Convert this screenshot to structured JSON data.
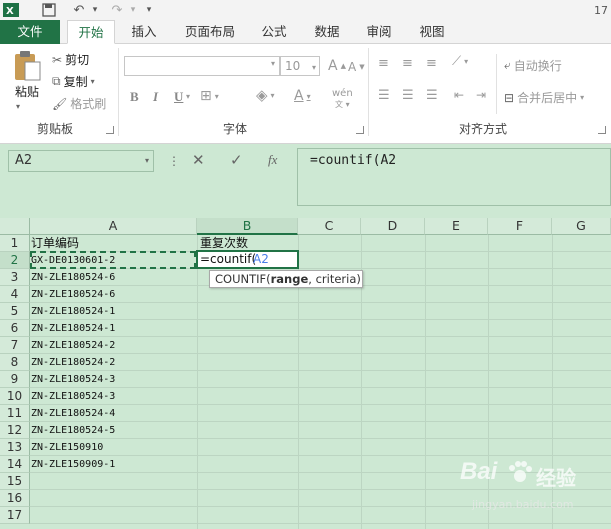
{
  "titlebar": {
    "number": "17"
  },
  "tabs": [
    {
      "label": "文件"
    },
    {
      "label": "开始"
    },
    {
      "label": "插入"
    },
    {
      "label": "页面布局"
    },
    {
      "label": "公式"
    },
    {
      "label": "数据"
    },
    {
      "label": "审阅"
    },
    {
      "label": "视图"
    }
  ],
  "clipboard": {
    "paste": "粘贴",
    "cut": "剪切",
    "copy": "复制",
    "format_painter": "格式刷",
    "group": "剪贴板"
  },
  "font": {
    "size": "10",
    "bold": "B",
    "italic": "I",
    "underline": "U",
    "group": "字体",
    "phonetic": "wén"
  },
  "alignment": {
    "wrap": "自动换行",
    "merge": "合并后居中",
    "group": "对齐方式"
  },
  "name_box": "A2",
  "formula": "=countif(A2",
  "columns": [
    "A",
    "B",
    "C",
    "D",
    "E",
    "F",
    "G"
  ],
  "rows": [
    "1",
    "2",
    "3",
    "4",
    "5",
    "6",
    "7",
    "8",
    "9",
    "10",
    "11",
    "12",
    "13",
    "14",
    "15",
    "16",
    "17"
  ],
  "cells_a": [
    "订单编码",
    "GX-DE0130601-2",
    "ZN-ZLE180524-6",
    "ZN-ZLE180524-6",
    "ZN-ZLE180524-1",
    "ZN-ZLE180524-1",
    "ZN-ZLE180524-2",
    "ZN-ZLE180524-2",
    "ZN-ZLE180524-3",
    "ZN-ZLE180524-3",
    "ZN-ZLE180524-4",
    "ZN-ZLE180524-5",
    "ZN-ZLE150910",
    "ZN-ZLE150909-1"
  ],
  "cell_b1": "重复次数",
  "cell_b2_prefix": "=countif(",
  "cell_b2_ref": "A2",
  "tooltip": {
    "func": "COUNTIF(",
    "arg1": "range",
    "rest": ", criteria)"
  },
  "watermark": {
    "brand": "Bai",
    "brand2": "经验",
    "url": "jingyan.baidu.com"
  },
  "colors": {
    "accent": "#217346",
    "sheet": "#cde8d3",
    "ref_blue": "#4a7ee8"
  }
}
